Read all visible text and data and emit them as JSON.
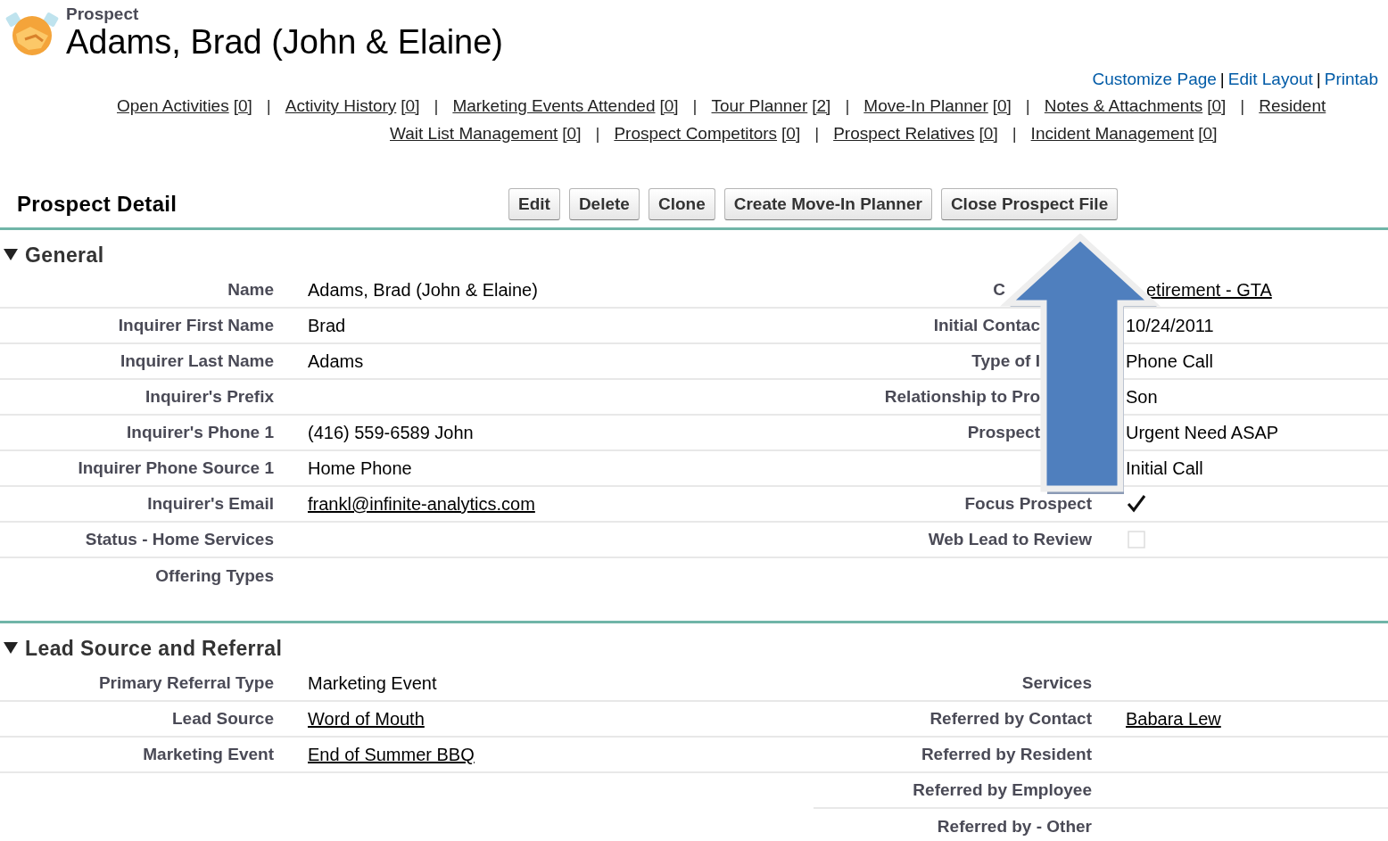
{
  "header": {
    "object_type": "Prospect",
    "title": "Adams, Brad (John & Elaine)"
  },
  "top_links": [
    {
      "kind": "link",
      "text": "Customize Page"
    },
    {
      "kind": "separator",
      "text": "|"
    },
    {
      "kind": "link",
      "text": "Edit Layout"
    },
    {
      "kind": "separator",
      "text": "|"
    },
    {
      "kind": "link",
      "text": "Printab"
    }
  ],
  "related_lists": [
    [
      {
        "kind": "link",
        "label": "Open Activities",
        "count": "[0]"
      },
      {
        "kind": "separator",
        "label": "|"
      },
      {
        "kind": "link",
        "label": "Activity History",
        "count": "[0]"
      },
      {
        "kind": "separator",
        "label": "|"
      },
      {
        "kind": "link",
        "label": "Marketing Events Attended",
        "count": "[0]"
      },
      {
        "kind": "separator",
        "label": "|"
      },
      {
        "kind": "link",
        "label": "Tour Planner",
        "count": "[2]"
      },
      {
        "kind": "separator",
        "label": "|"
      },
      {
        "kind": "link",
        "label": "Move-In Planner",
        "count": "[0]"
      },
      {
        "kind": "separator",
        "label": "|"
      },
      {
        "kind": "link",
        "label": "Notes & Attachments",
        "count": "[0]"
      },
      {
        "kind": "separator",
        "label": "|"
      },
      {
        "kind": "link",
        "label": "Resident"
      }
    ],
    [
      {
        "kind": "link",
        "label": "Wait List Management",
        "count": "[0]"
      },
      {
        "kind": "separator",
        "label": "|"
      },
      {
        "kind": "link",
        "label": "Prospect Competitors",
        "count": "[0]"
      },
      {
        "kind": "separator",
        "label": "|"
      },
      {
        "kind": "link",
        "label": "Prospect Relatives",
        "count": "[0]"
      },
      {
        "kind": "separator",
        "label": "|"
      },
      {
        "kind": "link",
        "label": "Incident Management",
        "count": "[0]"
      }
    ]
  ],
  "detail_title": "Prospect Detail",
  "buttons": [
    "Edit",
    "Delete",
    "Clone",
    "Create Move-In Planner",
    "Close Prospect File"
  ],
  "sections": [
    {
      "title": "General",
      "expanded": true,
      "rows": [
        [
          {
            "label": "Name",
            "value": "Adams, Brad (John & Elaine)"
          },
          {
            "label": "C",
            "label_covered": true,
            "value": "etirement - GTA",
            "kind": "link",
            "value_covered": true
          }
        ],
        [
          {
            "label": "Inquirer First Name",
            "value": "Brad"
          },
          {
            "label": "Initial Contac",
            "label_covered": true,
            "value": "10/24/2011"
          }
        ],
        [
          {
            "label": "Inquirer Last Name",
            "value": "Adams"
          },
          {
            "label": "Type of I",
            "label_covered": true,
            "value": "Phone Call"
          }
        ],
        [
          {
            "label": "Inquirer's Prefix"
          },
          {
            "label": "Relationship to Pro",
            "label_covered": true,
            "value": "Son"
          }
        ],
        [
          {
            "label": "Inquirer's Phone 1",
            "value": "(416) 559-6589 John"
          },
          {
            "label": "Prospect",
            "label_covered": true,
            "value": "Urgent Need ASAP"
          }
        ],
        [
          {
            "label": "Inquirer Phone Source 1",
            "value": "Home Phone"
          },
          {
            "value": "Initial Call"
          }
        ],
        [
          {
            "label": "Inquirer's Email",
            "value": "frankl@infinite-analytics.com",
            "kind": "link"
          },
          {
            "label": "Focus Prospect",
            "kind": "checkbox",
            "checked": true
          }
        ],
        [
          {
            "label": "Status - Home Services"
          },
          {
            "label": "Web Lead to Review",
            "kind": "checkbox",
            "checked": false
          }
        ],
        [
          {
            "label": "Offering Types"
          },
          {}
        ]
      ]
    },
    {
      "title": "Lead Source and Referral",
      "expanded": true,
      "rows": [
        [
          {
            "label": "Primary Referral Type",
            "value": "Marketing Event"
          },
          {
            "label": "Services"
          }
        ],
        [
          {
            "label": "Lead Source",
            "value": "Word of Mouth",
            "kind": "link"
          },
          {
            "label": "Referred by Contact",
            "value": "Babara Lew",
            "kind": "link"
          }
        ],
        [
          {
            "label": "Marketing Event",
            "value": "End of Summer BBQ",
            "kind": "link"
          },
          {
            "label": "Referred by Resident"
          }
        ],
        [
          null,
          {
            "label": "Referred by Employee"
          }
        ],
        [
          null,
          {
            "label": "Referred by - Other"
          }
        ]
      ]
    }
  ],
  "overlay": {
    "kind": "arrow"
  }
}
